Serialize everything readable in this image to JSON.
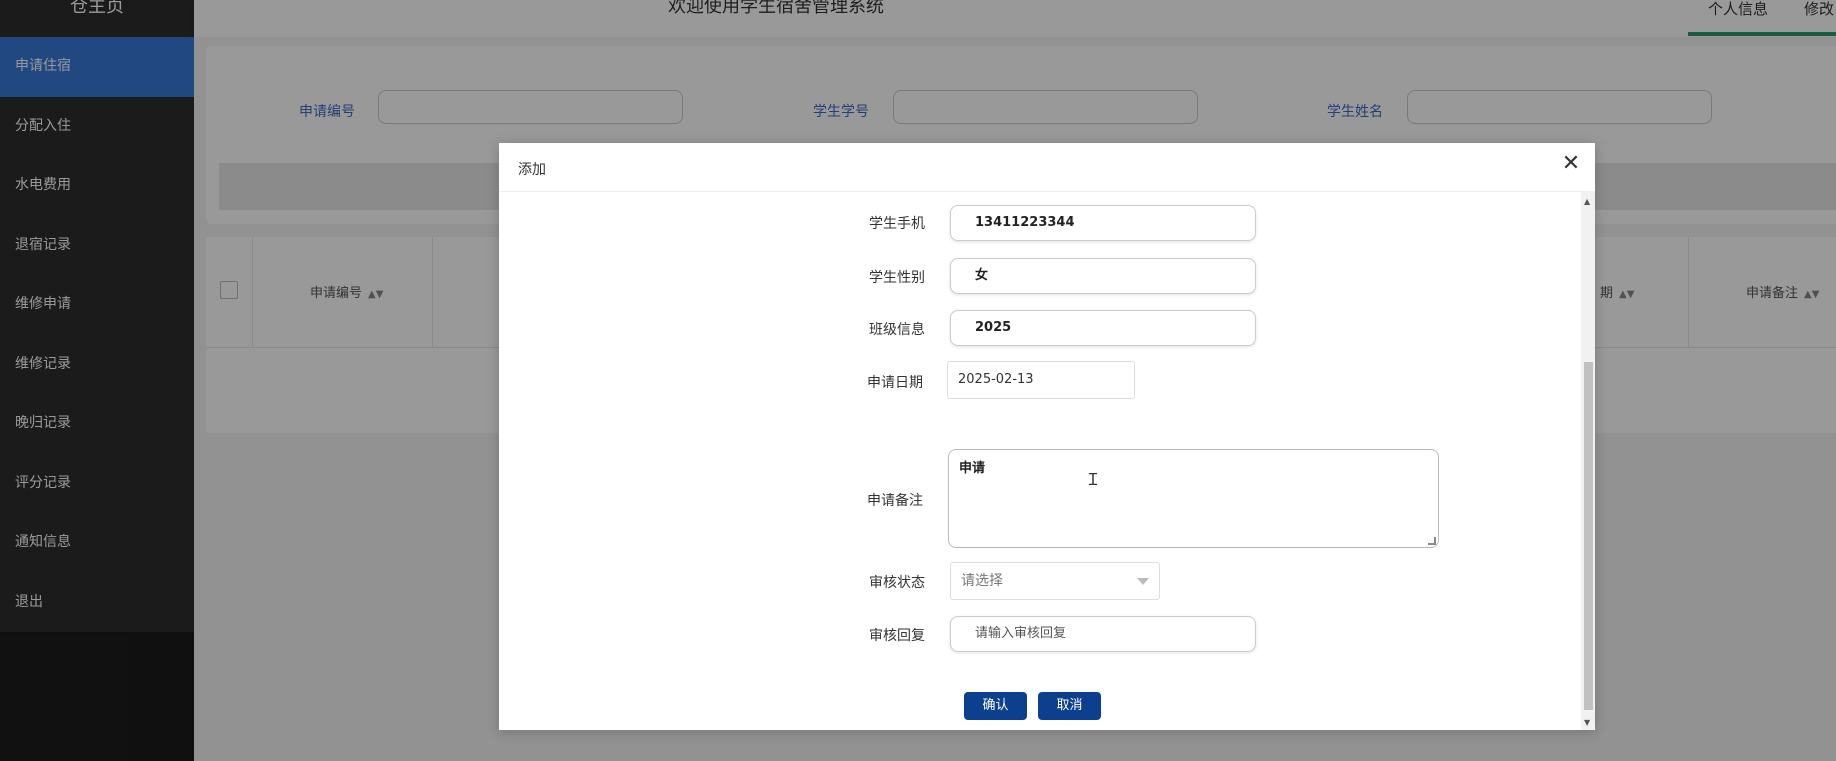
{
  "sidebar": {
    "home_label": "仓主页",
    "items": [
      {
        "label": "申请住宿"
      },
      {
        "label": "分配入住"
      },
      {
        "label": "水电费用"
      },
      {
        "label": "退宿记录"
      },
      {
        "label": "维修申请"
      },
      {
        "label": "维修记录"
      },
      {
        "label": "晚归记录"
      },
      {
        "label": "评分记录"
      },
      {
        "label": "通知信息"
      },
      {
        "label": "退出"
      }
    ],
    "active_index": 0,
    "active_color": "#3779d8"
  },
  "header": {
    "title": "欢迎使用学生宿舍管理系统",
    "links": [
      "个人信息",
      "修改"
    ],
    "active_tab_color": "#2e9a6b"
  },
  "search": {
    "labels": [
      "申请编号",
      "学生学号",
      "学生姓名"
    ]
  },
  "table": {
    "headers": [
      "申请编号",
      "期",
      "申请备注"
    ]
  },
  "dialog": {
    "title": "添加",
    "close_icon": "close-icon",
    "fields": {
      "phone": {
        "label": "学生手机",
        "value": "13411223344"
      },
      "gender": {
        "label": "学生性别",
        "value": "女"
      },
      "class_info": {
        "label": "班级信息",
        "value": "2025"
      },
      "apply_date": {
        "label": "申请日期",
        "value": "2025-02-13"
      },
      "remark": {
        "label": "申请备注",
        "value": "申请"
      },
      "review_status": {
        "label": "审核状态",
        "placeholder": "请选择"
      },
      "review_reply": {
        "label": "审核回复",
        "placeholder": "请输入审核回复"
      }
    },
    "confirm_label": "确认",
    "cancel_label": "取消",
    "button_color": "#0d3f8f"
  }
}
